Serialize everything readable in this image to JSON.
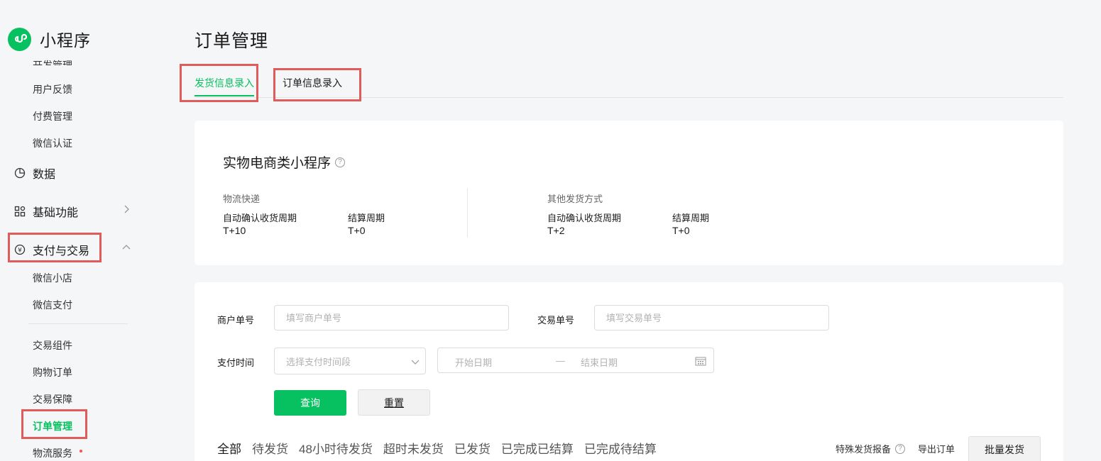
{
  "app": {
    "title": "小程序"
  },
  "sidebar": {
    "cut_item": "开发管理",
    "items_top": [
      "用户反馈",
      "付费管理",
      "微信认证"
    ],
    "group_data": "数据",
    "group_basic": "基础功能",
    "group_pay": "支付与交易",
    "pay_sub": [
      "微信小店",
      "微信支付"
    ],
    "pay_sub2": [
      "交易组件",
      "购物订单",
      "交易保障",
      "订单管理",
      "物流服务"
    ]
  },
  "page": {
    "title": "订单管理",
    "tabs": [
      "发货信息录入",
      "订单信息录入"
    ]
  },
  "info_card": {
    "title": "实物电商类小程序",
    "left": {
      "section": "物流快递",
      "confirm_label": "自动确认收货周期",
      "confirm_value": "T+10",
      "settle_label": "结算周期",
      "settle_value": "T+0"
    },
    "right": {
      "section": "其他发货方式",
      "confirm_label": "自动确认收货周期",
      "confirm_value": "T+2",
      "settle_label": "结算周期",
      "settle_value": "T+0"
    }
  },
  "filter": {
    "merchant_label": "商户单号",
    "merchant_placeholder": "填写商户单号",
    "trade_label": "交易单号",
    "trade_placeholder": "填写交易单号",
    "pay_time_label": "支付时间",
    "pay_time_placeholder": "选择支付时间段",
    "start_date": "开始日期",
    "range_sep": "—",
    "end_date": "结束日期",
    "query": "查询",
    "reset": "重置"
  },
  "status_tabs": [
    "全部",
    "待发货",
    "48小时待发货",
    "超时未发货",
    "已发货",
    "已完成已结算",
    "已完成待结算"
  ],
  "actions": {
    "special": "特殊发货报备",
    "export": "导出订单",
    "batch": "批量发货"
  },
  "colors": {
    "accent": "#07c160",
    "highlight": "#e15b5b",
    "dot": "#fa5151"
  }
}
